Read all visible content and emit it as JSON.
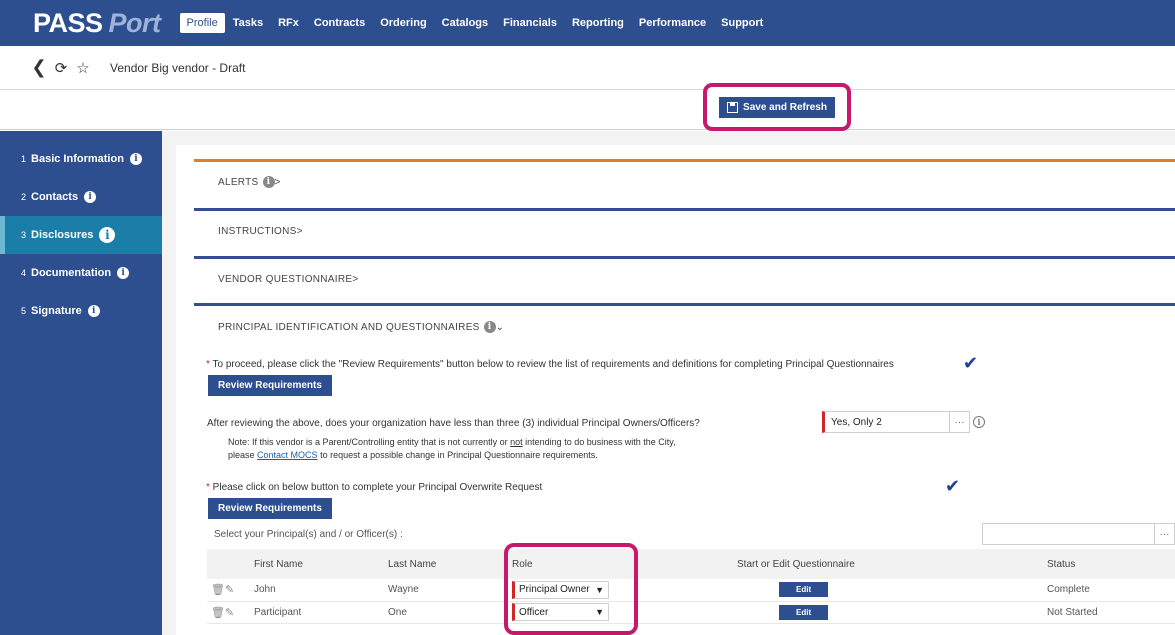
{
  "app": {
    "logo_main": "PASS",
    "logo_accent": "Port"
  },
  "nav": {
    "items": [
      {
        "label": "Profile",
        "active": true
      },
      {
        "label": "Tasks"
      },
      {
        "label": "RFx"
      },
      {
        "label": "Contracts"
      },
      {
        "label": "Ordering"
      },
      {
        "label": "Catalogs"
      },
      {
        "label": "Financials"
      },
      {
        "label": "Reporting"
      },
      {
        "label": "Performance"
      },
      {
        "label": "Support"
      }
    ]
  },
  "breadcrumb": {
    "title": "Vendor Big vendor - Draft"
  },
  "toolbar": {
    "save_label": "Save and Refresh"
  },
  "sidebar": {
    "items": [
      {
        "num": "1",
        "label": "Basic Information"
      },
      {
        "num": "2",
        "label": "Contacts"
      },
      {
        "num": "3",
        "label": "Disclosures",
        "active": true
      },
      {
        "num": "4",
        "label": "Documentation"
      },
      {
        "num": "5",
        "label": "Signature"
      }
    ]
  },
  "sections": {
    "alerts": "ALERTS",
    "instructions": "INSTRUCTIONS",
    "questionnaire": "VENDOR QUESTIONNAIRE",
    "principal": "PRINCIPAL IDENTIFICATION AND QUESTIONNAIRES"
  },
  "principal": {
    "proceed_text": "To proceed, please click the \"Review Requirements\" button below to review the list of requirements and definitions for completing Principal Questionnaires",
    "review_btn_1": "Review Requirements",
    "question": "After reviewing the above, does your organization have less than three (3) individual Principal Owners/Officers?",
    "answer": "Yes, Only 2",
    "note_line1_a": "Note: If this vendor is a Parent/Controlling entity that is not currently or ",
    "note_line1_not": "not",
    "note_line1_b": " intending to do business with the City,",
    "note_line2_a": "please ",
    "note_link": "Contact MOCS",
    "note_line2_b": " to request a possible change in Principal Questionnaire requirements.",
    "overwrite_text": "Please click on below button to complete your Principal Overwrite Request",
    "review_btn_2": "Review Requirements",
    "select_label": "Select your Principal(s) and / or Officer(s) :"
  },
  "table": {
    "headers": {
      "first": "First Name",
      "last": "Last Name",
      "role": "Role",
      "questionnaire": "Start or Edit Questionnaire",
      "status": "Status"
    },
    "rows": [
      {
        "first": "John",
        "last": "Wayne",
        "role": "Principal Owner",
        "edit": "Edit",
        "status": "Complete"
      },
      {
        "first": "Participant",
        "last": "One",
        "role": "Officer",
        "edit": "Edit",
        "status": "Not Started"
      }
    ]
  },
  "colors": {
    "brand": "#2e4f8f",
    "highlight": "#c8186c",
    "alert_bar": "#e07f2a",
    "active_tab": "#1a7ea8"
  }
}
